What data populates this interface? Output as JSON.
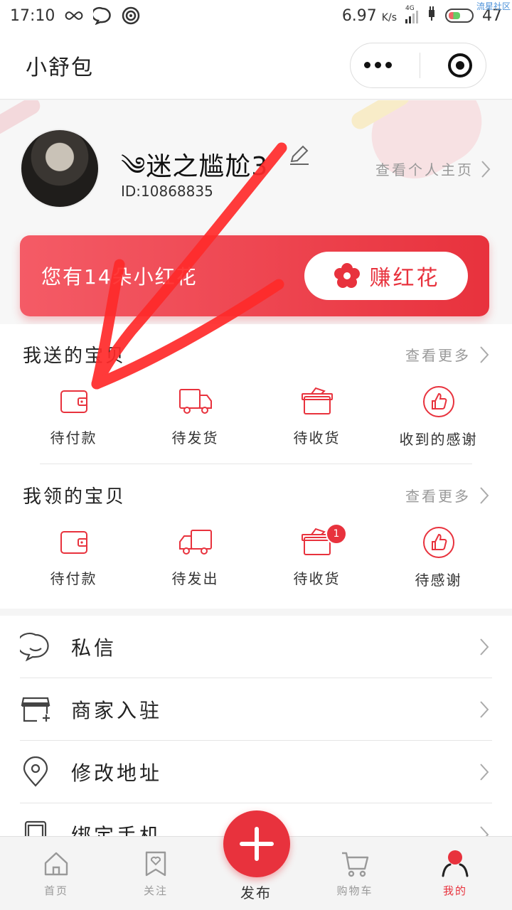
{
  "status_bar": {
    "time": "17:10",
    "speed": "6.97",
    "speed_unit": "K/s",
    "network": "4G",
    "battery": "47",
    "watermark": "流星社区"
  },
  "nav": {
    "title": "小舒包"
  },
  "profile": {
    "nickname": "༄迷之尴尬3",
    "user_id": "ID:10868835",
    "view_home": "查看个人主页"
  },
  "flower_card": {
    "message": "您有14朵小红花",
    "earn_button": "赚红花"
  },
  "sent": {
    "title": "我送的宝贝",
    "more": "查看更多",
    "items": [
      {
        "label": "待付款",
        "icon": "wallet-icon"
      },
      {
        "label": "待发货",
        "icon": "truck-icon"
      },
      {
        "label": "待收货",
        "icon": "box-icon"
      },
      {
        "label": "收到的感谢",
        "icon": "thumbs-up-icon"
      }
    ]
  },
  "received": {
    "title": "我领的宝贝",
    "more": "查看更多",
    "items": [
      {
        "label": "待付款",
        "icon": "wallet-icon"
      },
      {
        "label": "待发出",
        "icon": "truck-icon"
      },
      {
        "label": "待收货",
        "icon": "box-icon",
        "badge": "1"
      },
      {
        "label": "待感谢",
        "icon": "thumbs-up-icon"
      }
    ]
  },
  "menu": [
    {
      "label": "私信",
      "icon": "chat-icon"
    },
    {
      "label": "商家入驻",
      "icon": "store-icon"
    },
    {
      "label": "修改地址",
      "icon": "location-icon"
    },
    {
      "label": "绑定手机",
      "icon": "phone-icon"
    }
  ],
  "tabbar": {
    "home": "首页",
    "follow": "关注",
    "publish": "发布",
    "cart": "购物车",
    "me": "我的"
  },
  "colors": {
    "accent": "#e8323d",
    "overlay_arrow": "#ff2a2a"
  }
}
